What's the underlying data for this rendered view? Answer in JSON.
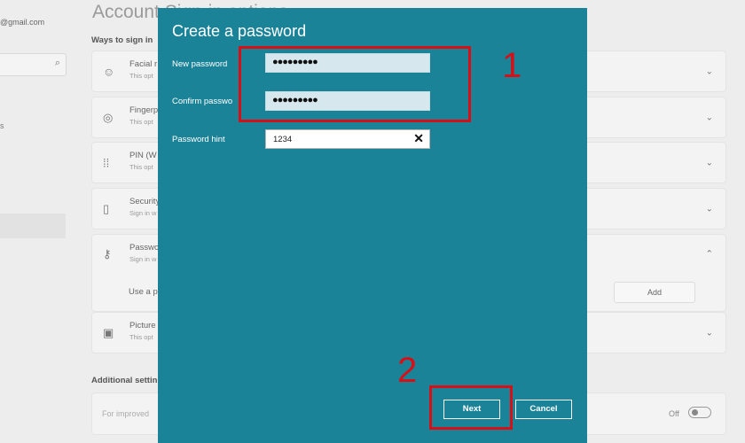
{
  "background": {
    "email_fragment": "@gmail.com",
    "left_fragment": "s",
    "page_title": "Account   Sign-in options",
    "ways_label": "Ways to sign in",
    "options": [
      {
        "title": "Facial r",
        "subtitle": "This opt",
        "icon": "face-icon"
      },
      {
        "title": "Fingerp",
        "subtitle": "This opt",
        "icon": "fingerprint-icon"
      },
      {
        "title": "PIN (W",
        "subtitle": "This opt",
        "icon": "keypad-icon"
      },
      {
        "title": "Security",
        "subtitle": "Sign in w",
        "icon": "usb-key-icon"
      },
      {
        "title": "Passwo",
        "subtitle": "Sign in w",
        "icon": "key-icon"
      },
      {
        "title": "Picture",
        "subtitle": "This opt",
        "icon": "picture-icon"
      }
    ],
    "use_a_password": "Use a p",
    "add_label": "Add",
    "additional_label": "Additional settin",
    "improved_text": "For improved",
    "off_label": "Off"
  },
  "dialog": {
    "title": "Create a password",
    "new_password_label": "New password",
    "new_password_value": "●●●●●●●●●",
    "confirm_password_label": "Confirm passwo",
    "confirm_password_value": "●●●●●●●●●",
    "hint_label": "Password hint",
    "hint_value": "1234",
    "next_label": "Next",
    "cancel_label": "Cancel"
  },
  "annotations": {
    "step1": "1",
    "step2": "2"
  },
  "colors": {
    "dialog_bg": "#1b8398",
    "annotation_red": "#d80f16"
  }
}
